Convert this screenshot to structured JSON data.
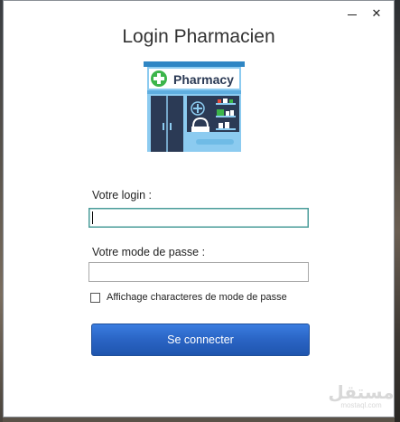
{
  "window": {
    "title": "Login Pharmacien",
    "controls": {
      "minimize_icon": "minimize-icon",
      "close_icon": "close-icon",
      "close_glyph": "✕"
    }
  },
  "logo": {
    "sign_text": "Pharmacy",
    "icon": "pharmacy-store-icon",
    "brand_color": "#3a99d8"
  },
  "form": {
    "login_label": "Votre login :",
    "login_value": "",
    "password_label": "Votre mode de passe :",
    "password_value": "",
    "show_password_label": "Affichage characteres de  mode de passe",
    "show_password_checked": false,
    "submit_label": "Se connecter",
    "accent_color": "#2a64c4"
  },
  "watermark": {
    "arabic": "مستقل",
    "latin": "mostaql.com"
  }
}
